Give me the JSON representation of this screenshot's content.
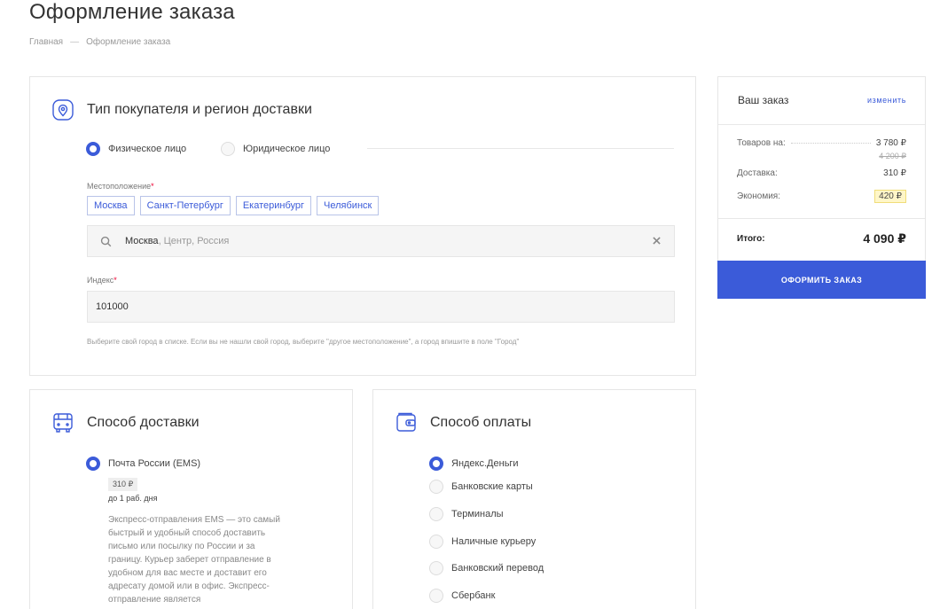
{
  "page": {
    "title": "Оформление заказа",
    "breadcrumb": [
      "Главная",
      "—",
      "Оформление заказа"
    ]
  },
  "region": {
    "title": "Тип покупателя и регион доставки",
    "buyer_types": [
      {
        "label": "Физическое лицо",
        "selected": true
      },
      {
        "label": "Юридическое лицо",
        "selected": false
      }
    ],
    "location_label": "Местоположение",
    "required_mark": "*",
    "cities": [
      "Москва",
      "Санкт-Петербург",
      "Екатеринбург",
      "Челябинск"
    ],
    "location_value": "Москва",
    "location_suffix": ", Центр, Россия",
    "index_label": "Индекс",
    "index_value": "101000",
    "hint": "Выберите свой город в списке. Если вы не нашли свой город, выберите \"другое местоположение\", а город впишите в поле \"Город\""
  },
  "delivery": {
    "title": "Способ доставки",
    "option_label": "Почта России (EMS)",
    "price": "310 ₽",
    "days": "до 1 раб. дня",
    "description": "Экспресс-отправления EMS — это самый быстрый и удобный способ доставить письмо или посылку по России и за границу. Курьер заберет отправление в удобном для вас месте и доставит его адресату домой или в офис. Экспресс-отправление является"
  },
  "payment": {
    "title": "Способ оплаты",
    "options": [
      {
        "label": "Яндекс.Деньги",
        "selected": true
      },
      {
        "label": "Банковские карты",
        "selected": false
      },
      {
        "label": "Терминалы",
        "selected": false
      },
      {
        "label": "Наличные курьеру",
        "selected": false
      },
      {
        "label": "Банковский перевод",
        "selected": false
      },
      {
        "label": "Сбербанк",
        "selected": false
      }
    ]
  },
  "order": {
    "title": "Ваш заказ",
    "edit": "изменить",
    "goods_label": "Товаров на:",
    "goods_value": "3 780 ₽",
    "goods_old": "4 200 ₽",
    "delivery_label": "Доставка:",
    "delivery_value": "310 ₽",
    "saving_label": "Экономия:",
    "saving_value": "420 ₽",
    "total_label": "Итого:",
    "total_value": "4 090 ₽",
    "submit": "ОФОРМИТЬ ЗАКАЗ"
  },
  "colors": {
    "accent": "#3b5bd9",
    "badge": "#fff6c8"
  },
  "icons": {
    "region": "location-pin-icon",
    "delivery": "bus-icon",
    "payment": "wallet-icon",
    "search": "search-icon",
    "clear": "close-icon"
  }
}
